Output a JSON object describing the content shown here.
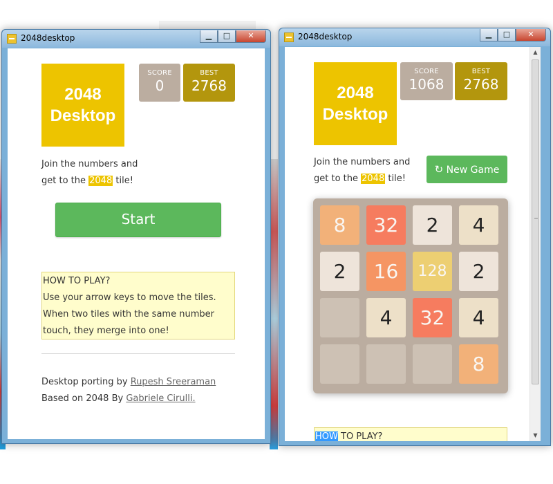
{
  "windows": [
    {
      "title": "2048desktop",
      "controls": {
        "minimize": "▁",
        "maximize": "□",
        "close": "✕"
      },
      "logo": {
        "line1": "2048",
        "line2": "Desktop"
      },
      "score": {
        "label": "SCORE",
        "value": "0"
      },
      "best": {
        "label": "BEST",
        "value": "2768"
      },
      "intro": {
        "line1": "Join the numbers and",
        "line2_pre": "get to the",
        "highlight": "2048",
        "line2_post": "tile!"
      },
      "start_label": "Start",
      "howto": {
        "heading": "HOW TO PLAY?",
        "line1": "Use your arrow keys to move the tiles.",
        "line2": "When two tiles with the same number",
        "line3": "touch, they merge into one!"
      },
      "footer": {
        "port_prefix": "Desktop porting by",
        "port_author": "Rupesh Sreeraman",
        "based_prefix": "Based on 2048 By",
        "based_author": "Gabriele Cirulli."
      }
    },
    {
      "title": "2048desktop",
      "controls": {
        "minimize": "▁",
        "maximize": "□",
        "close": "✕"
      },
      "logo": {
        "line1": "2048",
        "line2": "Desktop"
      },
      "score": {
        "label": "SCORE",
        "value": "1068"
      },
      "best": {
        "label": "BEST",
        "value": "2768"
      },
      "intro": {
        "line1": "Join the numbers and",
        "line2_pre": "get to the",
        "highlight": "2048",
        "line2_post": "tile!"
      },
      "new_game_label": "New Game",
      "new_game_icon": "refresh-icon",
      "board": [
        [
          "8",
          "32",
          "2",
          "4"
        ],
        [
          "2",
          "16",
          "128",
          "2"
        ],
        [
          "",
          "4",
          "32",
          "4"
        ],
        [
          "",
          "",
          "",
          "8"
        ]
      ],
      "howto_selected": "HOW",
      "howto_rest": "TO PLAY?",
      "scroll": {
        "up": "▲",
        "down": "▼"
      }
    }
  ],
  "colors": {
    "tile_2": "#eee4da",
    "tile_4": "#ede0c8",
    "tile_8": "#f2b179",
    "tile_16": "#f59563",
    "tile_32": "#f67c5f",
    "tile_128": "#edcf72",
    "empty": "#cdc1b4",
    "logo": "#edc400",
    "button": "#5cb85c"
  }
}
